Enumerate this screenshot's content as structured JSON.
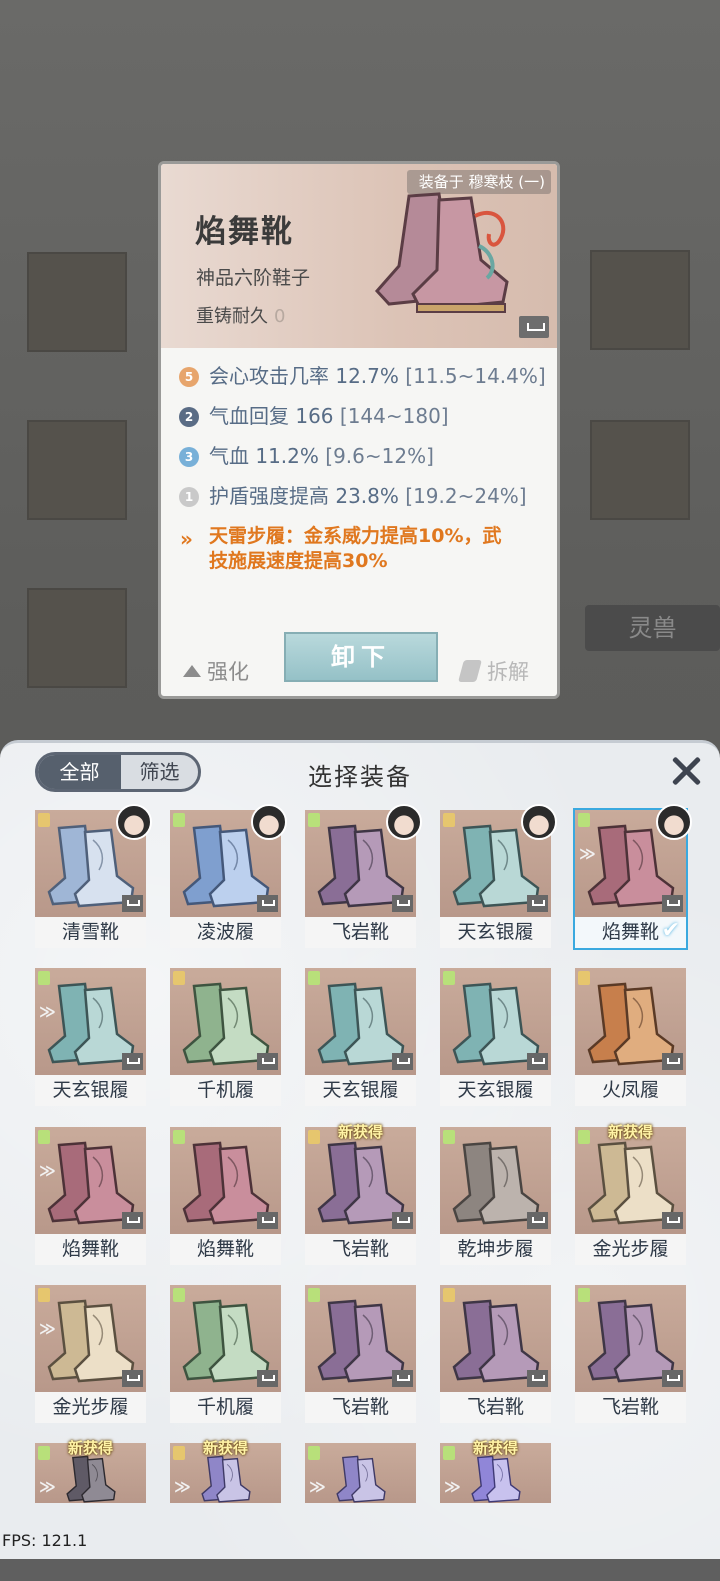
{
  "card": {
    "equipped_on": "装备于 穆寒枝 (一)",
    "name": "焰舞靴",
    "grade": "神品六阶鞋子",
    "reforge_label": "重铸耐久",
    "reforge_value": "0",
    "stats": [
      {
        "icon": "5",
        "icon_color": "#e7a56c",
        "text": "会心攻击几率 12.7%",
        "range": "[11.5~14.4%]"
      },
      {
        "icon": "2",
        "icon_color": "#5a6c85",
        "text": "气血回复 166",
        "range": "[144~180]"
      },
      {
        "icon": "3",
        "icon_color": "#78b0d8",
        "text": "气血 11.2%",
        "range": "[9.6~12%]"
      },
      {
        "icon": "1",
        "icon_color": "#c9c9c9",
        "text": "护盾强度提高 23.8%",
        "range": "[19.2~24%]"
      }
    ],
    "set_line1": "天雷步履：金系威力提高10%，武",
    "set_line2": "技施展速度提高30%",
    "btn_enhance": "强化",
    "btn_unequip": "卸下",
    "btn_dismantle": "拆解"
  },
  "background": {
    "spirit_beast_label": "灵兽"
  },
  "panel": {
    "tab_all": "全部",
    "tab_filter": "筛选",
    "title": "选择装备",
    "items": [
      {
        "name": "清雪靴",
        "tone": "ice",
        "avatar": true
      },
      {
        "name": "凌波履",
        "tone": "blue",
        "avatar": true
      },
      {
        "name": "飞岩靴",
        "tone": "purple",
        "avatar": true
      },
      {
        "name": "天玄银履",
        "tone": "teal",
        "avatar": true
      },
      {
        "name": "焰舞靴",
        "tone": "rose",
        "avatar": true,
        "selected": true
      },
      {
        "name": "天玄银履",
        "tone": "teal"
      },
      {
        "name": "千机履",
        "tone": "green"
      },
      {
        "name": "天玄银履",
        "tone": "teal"
      },
      {
        "name": "天玄银履",
        "tone": "teal"
      },
      {
        "name": "火凤履",
        "tone": "orange"
      },
      {
        "name": "焰舞靴",
        "tone": "rose"
      },
      {
        "name": "焰舞靴",
        "tone": "rose"
      },
      {
        "name": "飞岩靴",
        "tone": "purple",
        "new": true
      },
      {
        "name": "乾坤步履",
        "tone": "grey"
      },
      {
        "name": "金光步履",
        "tone": "cream",
        "new": true
      },
      {
        "name": "金光步履",
        "tone": "cream"
      },
      {
        "name": "千机履",
        "tone": "green"
      },
      {
        "name": "飞岩靴",
        "tone": "purple"
      },
      {
        "name": "飞岩靴",
        "tone": "purple"
      },
      {
        "name": "飞岩靴",
        "tone": "purple"
      },
      {
        "name": "",
        "tone": "dark",
        "new": true
      },
      {
        "name": "",
        "tone": "violet",
        "new": true
      },
      {
        "name": "",
        "tone": "violet"
      },
      {
        "name": "",
        "tone": "crystal",
        "new": true
      }
    ],
    "new_label": "新获得"
  },
  "fps": "FPS: 121.1",
  "colors": {
    "set_text": "#e0781f",
    "stat_text": "#576c86",
    "selected_border": "#3aa9df"
  }
}
